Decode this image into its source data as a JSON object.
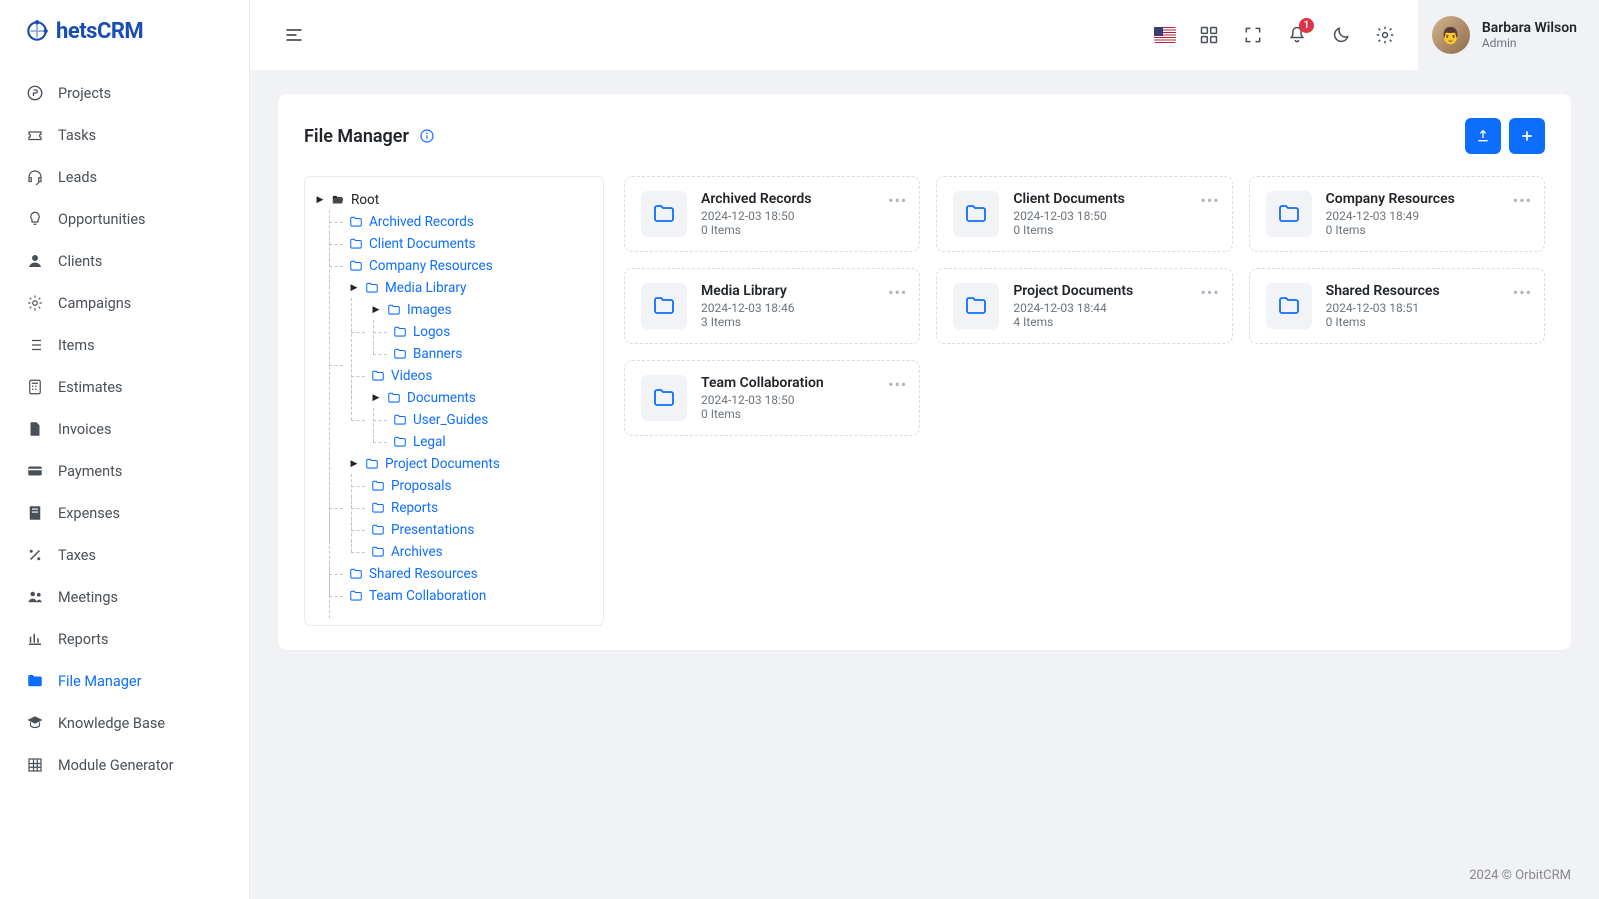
{
  "logo_text": "hetsCRM",
  "nav": [
    {
      "label": "Projects",
      "icon": "p-circle"
    },
    {
      "label": "Tasks",
      "icon": "ticket"
    },
    {
      "label": "Leads",
      "icon": "headset"
    },
    {
      "label": "Opportunities",
      "icon": "bulb"
    },
    {
      "label": "Clients",
      "icon": "user"
    },
    {
      "label": "Campaigns",
      "icon": "gear"
    },
    {
      "label": "Items",
      "icon": "list"
    },
    {
      "label": "Estimates",
      "icon": "calc"
    },
    {
      "label": "Invoices",
      "icon": "file"
    },
    {
      "label": "Payments",
      "icon": "card"
    },
    {
      "label": "Expenses",
      "icon": "receipt"
    },
    {
      "label": "Taxes",
      "icon": "percent"
    },
    {
      "label": "Meetings",
      "icon": "people"
    },
    {
      "label": "Reports",
      "icon": "chart"
    },
    {
      "label": "File Manager",
      "icon": "folder",
      "active": true
    },
    {
      "label": "Knowledge Base",
      "icon": "grad"
    },
    {
      "label": "Module Generator",
      "icon": "grid"
    }
  ],
  "topbar": {
    "notification_count": "1",
    "user_name": "Barbara Wilson",
    "user_role": "Admin",
    "avatar_initials": "👨"
  },
  "page": {
    "title": "File Manager"
  },
  "tree_root": "Root",
  "tree": [
    {
      "label": "Archived Records"
    },
    {
      "label": "Client Documents"
    },
    {
      "label": "Company Resources"
    },
    {
      "label": "Media Library",
      "expanded": true,
      "children": [
        {
          "label": "Images",
          "expanded": true,
          "children": [
            {
              "label": "Logos"
            },
            {
              "label": "Banners"
            }
          ]
        },
        {
          "label": "Videos"
        },
        {
          "label": "Documents",
          "expanded": true,
          "children": [
            {
              "label": "User_Guides"
            },
            {
              "label": "Legal"
            }
          ]
        }
      ]
    },
    {
      "label": "Project Documents",
      "expanded": true,
      "children": [
        {
          "label": "Proposals"
        },
        {
          "label": "Reports"
        },
        {
          "label": "Presentations"
        },
        {
          "label": "Archives"
        }
      ]
    },
    {
      "label": "Shared Resources"
    },
    {
      "label": "Team Collaboration"
    }
  ],
  "folders": [
    {
      "name": "Archived Records",
      "date": "2024-12-03 18:50",
      "items": "0 Items"
    },
    {
      "name": "Client Documents",
      "date": "2024-12-03 18:50",
      "items": "0 Items"
    },
    {
      "name": "Company Resources",
      "date": "2024-12-03 18:49",
      "items": "0 Items"
    },
    {
      "name": "Media Library",
      "date": "2024-12-03 18:46",
      "items": "3 Items"
    },
    {
      "name": "Project Documents",
      "date": "2024-12-03 18:44",
      "items": "4 Items"
    },
    {
      "name": "Shared Resources",
      "date": "2024-12-03 18:51",
      "items": "0 Items"
    },
    {
      "name": "Team Collaboration",
      "date": "2024-12-03 18:50",
      "items": "0 Items"
    }
  ],
  "footer": "2024 © OrbitCRM"
}
